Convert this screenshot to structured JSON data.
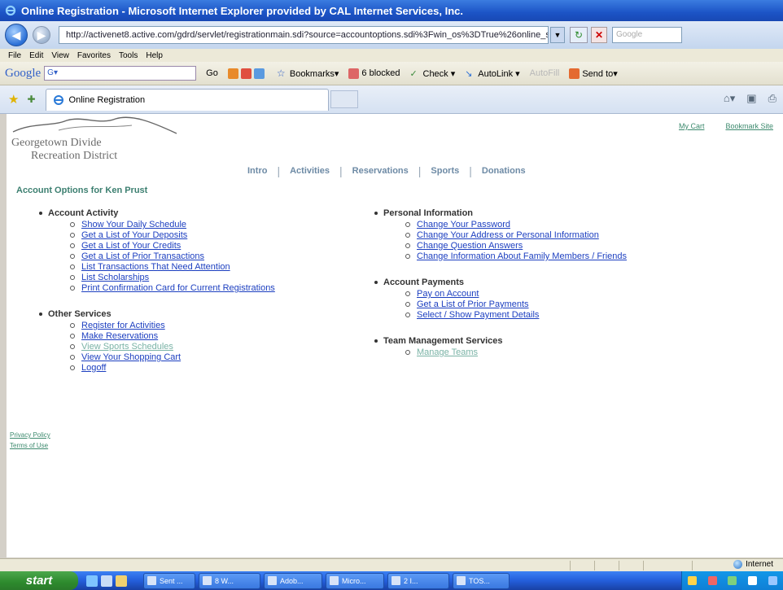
{
  "window": {
    "title": "Online Registration - Microsoft Internet Explorer provided by CAL Internet Services, Inc."
  },
  "address_bar": {
    "url": "http://activenet8.active.com/gdrd/servlet/registrationmain.sdi?source=accountoptions.sdi%3Fwin_os%3DTrue%26online_s",
    "search_placeholder": "Google"
  },
  "menu": [
    "File",
    "Edit",
    "View",
    "Favorites",
    "Tools",
    "Help"
  ],
  "google_toolbar": {
    "logo": "Google",
    "search_text": "G▾",
    "go": "Go",
    "bookmarks": "Bookmarks▾",
    "blocked": "6 blocked",
    "check": "Check ▾",
    "autolink": "AutoLink ▾",
    "autofill": "AutoFill",
    "sendto": "Send to▾"
  },
  "tab": {
    "label": "Online Registration"
  },
  "site": {
    "logo_line1": "Georgetown Divide",
    "logo_line2": "Recreation District",
    "top_links": [
      "My Cart",
      "Bookmark Site"
    ],
    "nav": [
      "Intro",
      "Activities",
      "Reservations",
      "Sports",
      "Donations"
    ],
    "page_title": "Account Options for Ken Prust",
    "left_sections": [
      {
        "heading": "Account Activity",
        "links": [
          {
            "label": "Show Your Daily Schedule",
            "visited": false
          },
          {
            "label": "Get a List of Your Deposits",
            "visited": false
          },
          {
            "label": "Get a List of Your Credits",
            "visited": false
          },
          {
            "label": "Get a List of Prior Transactions",
            "visited": false
          },
          {
            "label": "List Transactions That Need Attention",
            "visited": false
          },
          {
            "label": "List Scholarships",
            "visited": false
          },
          {
            "label": "Print Confirmation Card for Current Registrations",
            "visited": false
          }
        ]
      },
      {
        "heading": "Other Services",
        "links": [
          {
            "label": "Register for Activities",
            "visited": false
          },
          {
            "label": "Make Reservations",
            "visited": false
          },
          {
            "label": "View Sports Schedules",
            "visited": true
          },
          {
            "label": "View Your Shopping Cart",
            "visited": false
          },
          {
            "label": "Logoff",
            "visited": false
          }
        ]
      }
    ],
    "right_sections": [
      {
        "heading": "Personal Information",
        "links": [
          {
            "label": "Change Your Password",
            "visited": false
          },
          {
            "label": "Change Your Address or Personal Information",
            "visited": false
          },
          {
            "label": "Change Question Answers",
            "visited": false
          },
          {
            "label": "Change Information About Family Members / Friends",
            "visited": false
          }
        ]
      },
      {
        "heading": "Account Payments",
        "links": [
          {
            "label": "Pay on Account",
            "visited": false
          },
          {
            "label": "Get a List of Prior Payments",
            "visited": false
          },
          {
            "label": "Select / Show Payment Details",
            "visited": false
          }
        ]
      },
      {
        "heading": "Team Management Services",
        "links": [
          {
            "label": "Manage Teams",
            "visited": true
          }
        ]
      }
    ],
    "footer_links": [
      "Privacy Policy",
      "Terms of Use"
    ]
  },
  "status_bar": {
    "zone": "Internet"
  },
  "taskbar": {
    "start": "start",
    "buttons": [
      "Sent ...",
      "8 W...",
      "Adob...",
      "Micro...",
      "2 I...",
      "TOS..."
    ]
  },
  "colors": {
    "link": "#1c3fc0",
    "visited_link": "#7ab3a6",
    "site_accent": "#3c7f70",
    "nav_text": "#6d8aa5"
  }
}
